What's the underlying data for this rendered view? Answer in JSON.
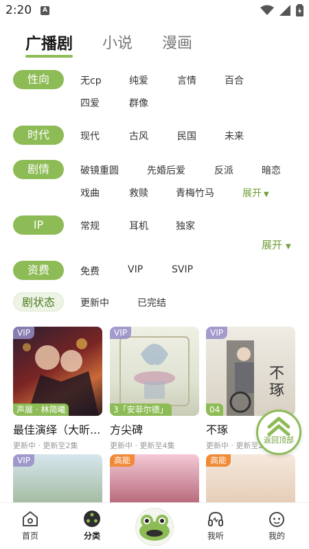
{
  "status": {
    "time": "2:20",
    "notif_letter": "A"
  },
  "tabs": [
    {
      "label": "广播剧"
    },
    {
      "label": "小说"
    },
    {
      "label": "漫画"
    }
  ],
  "filters": {
    "orientation": {
      "label": "性向",
      "options": [
        "无cp",
        "纯爱",
        "言情",
        "百合",
        "四爱",
        "群像"
      ]
    },
    "era": {
      "label": "时代",
      "options": [
        "现代",
        "古风",
        "民国",
        "未来"
      ]
    },
    "plot": {
      "label": "剧情",
      "options": [
        "破镜重圆",
        "先婚后爱",
        "反派",
        "暗恋",
        "戏曲",
        "救赎",
        "青梅竹马"
      ],
      "expand": "展开"
    },
    "ip": {
      "label": "IP",
      "options": [
        "常规",
        "耳机",
        "独家"
      ]
    },
    "expand_all": "展开",
    "fee": {
      "label": "资费",
      "options": [
        "免费",
        "VIP",
        "SVIP"
      ]
    },
    "state": {
      "label": "剧状态",
      "options": [
        "更新中",
        "已完结"
      ]
    }
  },
  "cards": [
    {
      "badge": "VIP",
      "tag": "声展 · 林简曦",
      "title": "最佳演绎（大昕...",
      "sub": "更新中 · 更新至2集"
    },
    {
      "badge": "VIP",
      "tag": "3「安菲尔德」",
      "title": "方尖碑",
      "sub": "更新中 · 更新至4集"
    },
    {
      "badge": "VIP",
      "tag": "04",
      "title": "不琢",
      "sub": "更新中 · 更新至2集"
    }
  ],
  "cards_row2": [
    {
      "badge": "VIP"
    },
    {
      "badge": "高能"
    },
    {
      "badge": "高能"
    }
  ],
  "back_to_top": "返回顶部",
  "nav": {
    "home": "首页",
    "category": "分类",
    "listen": "我听",
    "mine": "我的"
  },
  "colors": {
    "accent": "#8dbb55",
    "accent_text": "#6f9d35",
    "hot": "#f08a36"
  }
}
